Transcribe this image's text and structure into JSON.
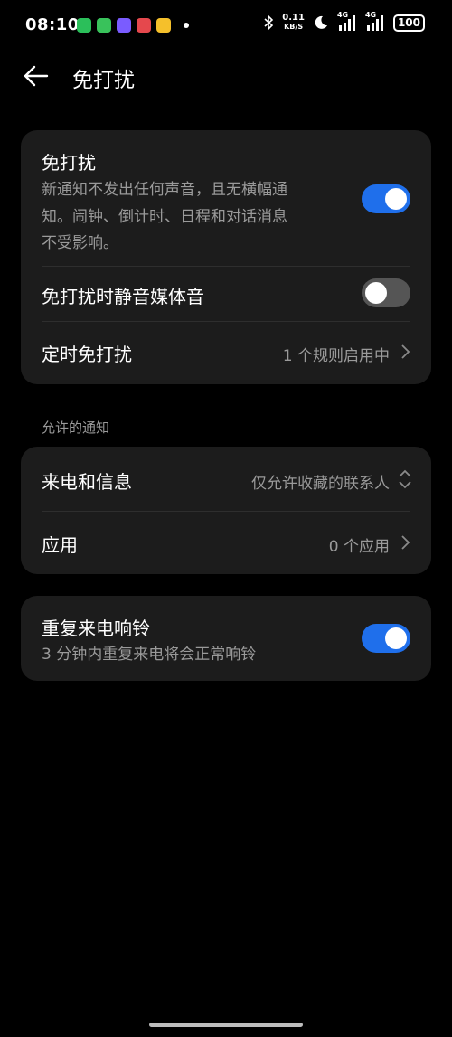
{
  "status_bar": {
    "time": "08:10",
    "speed_value": "0.11",
    "speed_unit": "KB/S",
    "network1": "4G",
    "network2": "4G",
    "battery": "100",
    "app_colors": [
      "#2bbf5a",
      "#39c25b",
      "#7a5cff",
      "#e5484d",
      "#f5c02b"
    ]
  },
  "header": {
    "title": "免打扰"
  },
  "dnd_card": {
    "main_title": "免打扰",
    "main_desc_line1": "新通知不发出任何声音，且无横幅通",
    "main_desc_line2": "知。闹钟、倒计时、日程和对话消息",
    "main_desc_line3": "不受影响。",
    "main_toggle": "on",
    "mute_media_title": "免打扰时静音媒体音",
    "mute_media_toggle": "off",
    "scheduled_title": "定时免打扰",
    "scheduled_value": "1 个规则启用中"
  },
  "allowed_section": {
    "label": "允许的通知",
    "calls_title": "来电和信息",
    "calls_value": "仅允许收藏的联系人",
    "apps_title": "应用",
    "apps_value": "0 个应用"
  },
  "repeat_card": {
    "title": "重复来电响铃",
    "desc": "3 分钟内重复来电将会正常响铃",
    "toggle": "on"
  },
  "colors": {
    "accent": "#1f6feb",
    "card_bg": "#1c1c1c",
    "secondary_text": "#9a9a9a"
  }
}
